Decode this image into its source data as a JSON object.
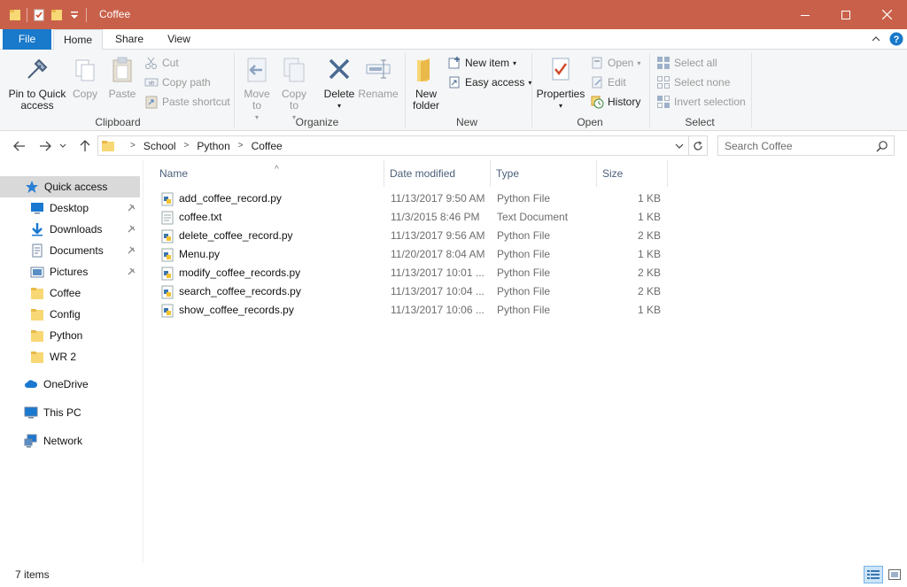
{
  "window": {
    "title": "Coffee"
  },
  "ribbon_tabs": [
    "File",
    "Home",
    "Share",
    "View"
  ],
  "ribbon": {
    "clipboard": {
      "label": "Clipboard",
      "pin": "Pin to Quick access",
      "copy": "Copy",
      "paste": "Paste",
      "cut": "Cut",
      "copy_path": "Copy path",
      "paste_shortcut": "Paste shortcut"
    },
    "organize": {
      "label": "Organize",
      "move_to": "Move to",
      "copy_to": "Copy to",
      "delete": "Delete",
      "rename": "Rename"
    },
    "new": {
      "label": "New",
      "new_folder": "New folder",
      "new_item": "New item",
      "easy_access": "Easy access"
    },
    "open": {
      "label": "Open",
      "properties": "Properties",
      "open": "Open",
      "edit": "Edit",
      "history": "History"
    },
    "select": {
      "label": "Select",
      "select_all": "Select all",
      "select_none": "Select none",
      "invert_selection": "Invert selection"
    }
  },
  "address": {
    "crumbs": [
      "School",
      "Python",
      "Coffee"
    ],
    "search_placeholder": "Search Coffee"
  },
  "nav_pane": {
    "quick_access": "Quick access",
    "items": [
      {
        "label": "Desktop",
        "icon": "desktop-icon",
        "pinned": true
      },
      {
        "label": "Downloads",
        "icon": "downloads-icon",
        "pinned": true
      },
      {
        "label": "Documents",
        "icon": "documents-icon",
        "pinned": true
      },
      {
        "label": "Pictures",
        "icon": "pictures-icon",
        "pinned": true
      },
      {
        "label": "Coffee",
        "icon": "folder-icon",
        "pinned": false
      },
      {
        "label": "Config",
        "icon": "folder-icon",
        "pinned": false
      },
      {
        "label": "Python",
        "icon": "folder-icon",
        "pinned": false
      },
      {
        "label": "WR 2",
        "icon": "folder-icon",
        "pinned": false
      }
    ],
    "onedrive": "OneDrive",
    "this_pc": "This PC",
    "network": "Network"
  },
  "columns": {
    "name": "Name",
    "date": "Date modified",
    "type": "Type",
    "size": "Size"
  },
  "files": [
    {
      "name": "add_coffee_record.py",
      "date": "11/13/2017 9:50 AM",
      "type": "Python File",
      "size": "1 KB",
      "icon": "python-file-icon"
    },
    {
      "name": "coffee.txt",
      "date": "11/3/2015 8:46 PM",
      "type": "Text Document",
      "size": "1 KB",
      "icon": "text-file-icon"
    },
    {
      "name": "delete_coffee_record.py",
      "date": "11/13/2017 9:56 AM",
      "type": "Python File",
      "size": "2 KB",
      "icon": "python-file-icon"
    },
    {
      "name": "Menu.py",
      "date": "11/20/2017 8:04 AM",
      "type": "Python File",
      "size": "1 KB",
      "icon": "python-file-icon"
    },
    {
      "name": "modify_coffee_records.py",
      "date": "11/13/2017 10:01 ...",
      "type": "Python File",
      "size": "2 KB",
      "icon": "python-file-icon"
    },
    {
      "name": "search_coffee_records.py",
      "date": "11/13/2017 10:04 ...",
      "type": "Python File",
      "size": "2 KB",
      "icon": "python-file-icon"
    },
    {
      "name": "show_coffee_records.py",
      "date": "11/13/2017 10:06 ...",
      "type": "Python File",
      "size": "1 KB",
      "icon": "python-file-icon"
    }
  ],
  "status": {
    "count": "7 items"
  },
  "colors": {
    "titlebar": "#c9614a",
    "file_tab": "#1979ca",
    "selected_nav": "#d9d9d9",
    "folder": "#f8d775"
  }
}
